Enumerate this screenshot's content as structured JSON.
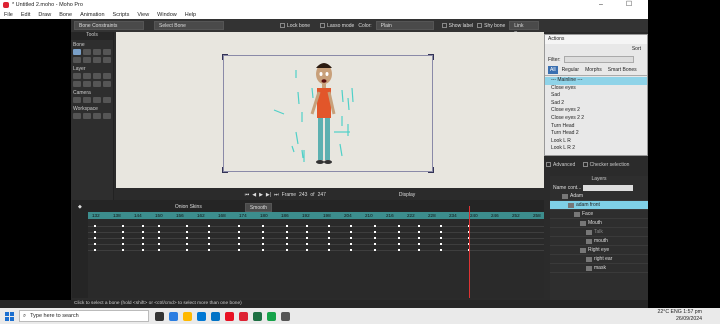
{
  "window": {
    "title": "* Untitled 2.moho - Moho Pro",
    "min": "–",
    "max": "☐",
    "close": "✕"
  },
  "menu": [
    "File",
    "Edit",
    "Draw",
    "Bone",
    "Animation",
    "Scripts",
    "View",
    "Window",
    "Help"
  ],
  "options": {
    "bone_constraints": "Bone Constraints",
    "select_bone": "Select Bone",
    "lock_bone": "Lock bone",
    "lasso_mode": "Lasso mode",
    "color_label": "Color:",
    "color_value": "Plain",
    "show_label": "Show label",
    "shy_bone": "Shy bone",
    "link_bones": "Link Bones"
  },
  "tools": {
    "title": "Tools",
    "sections": [
      "Bone",
      "Layer",
      "Camera",
      "Workspace"
    ]
  },
  "controls": {
    "frame_label": "Frame",
    "frame_value": "243",
    "of_label": "of",
    "of_value": "247",
    "display": "Display"
  },
  "actions": {
    "title": "Actions",
    "sort": "Sort",
    "filter": "Filter:",
    "tabs": [
      "All",
      "Regular",
      "Morphs",
      "Smart Bones"
    ],
    "items": [
      "--- Mainline ---",
      "Close eyes",
      "Sad",
      "Sad 2",
      "Close eyes 2",
      "Close eyes 2 2",
      "Turn Head",
      "Turn Head 2",
      "Look L R",
      "Look L R 2"
    ],
    "advanced": "Advanced",
    "checker": "Checker selection"
  },
  "layers": {
    "title": "Layers",
    "name_label": "Name cont...",
    "rows": [
      "Adam",
      "adam front",
      "Face",
      "Mouth",
      "Talk",
      "mouth",
      "Right eye",
      "right ear",
      "mask"
    ]
  },
  "timeline": {
    "smooth": "Smooth",
    "onion": "Onion Skins",
    "ruler": [
      "132",
      "138",
      "144",
      "150",
      "156",
      "162",
      "168",
      "174",
      "180",
      "186",
      "192",
      "198",
      "204",
      "210",
      "216",
      "222",
      "228",
      "234",
      "240",
      "246",
      "252",
      "258"
    ]
  },
  "status": "Click to select a bone (hold <shift> or <ctrl/cmd> to select more than one bone)",
  "taskbar": {
    "search": "Type here to search",
    "temp": "22°C",
    "lang": "ENG",
    "time": "1:57 pm",
    "date": "26/09/2024"
  }
}
